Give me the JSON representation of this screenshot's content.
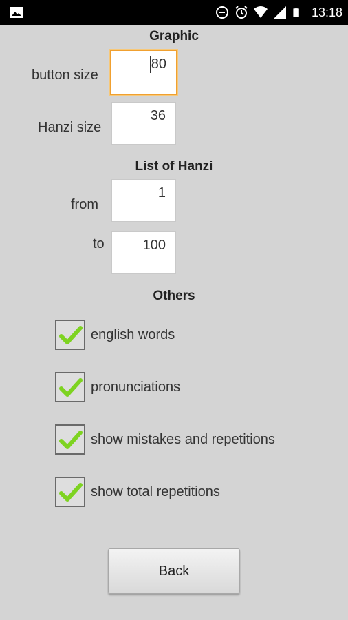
{
  "status_bar": {
    "time": "13:18",
    "icons": [
      "image-icon",
      "sync-icon",
      "alarm-icon",
      "wifi-icon",
      "signal-icon",
      "battery-icon"
    ]
  },
  "graphic": {
    "title": "Graphic",
    "button_size_label": "button size",
    "button_size_value": "80",
    "hanzi_size_label": "Hanzi size",
    "hanzi_size_value": "36"
  },
  "list": {
    "title": "List of Hanzi",
    "from_label": "from",
    "from_value": "1",
    "to_label": "to",
    "to_value": "100"
  },
  "others": {
    "title": "Others",
    "options": [
      {
        "label": "english words",
        "checked": true
      },
      {
        "label": "pronunciations",
        "checked": true
      },
      {
        "label": "show mistakes and repetitions",
        "checked": true
      },
      {
        "label": "show total repetitions",
        "checked": true
      }
    ]
  },
  "back_label": "Back",
  "colors": {
    "background": "#d4d4d4",
    "focus": "#f0a030",
    "check": "#7ed321"
  }
}
